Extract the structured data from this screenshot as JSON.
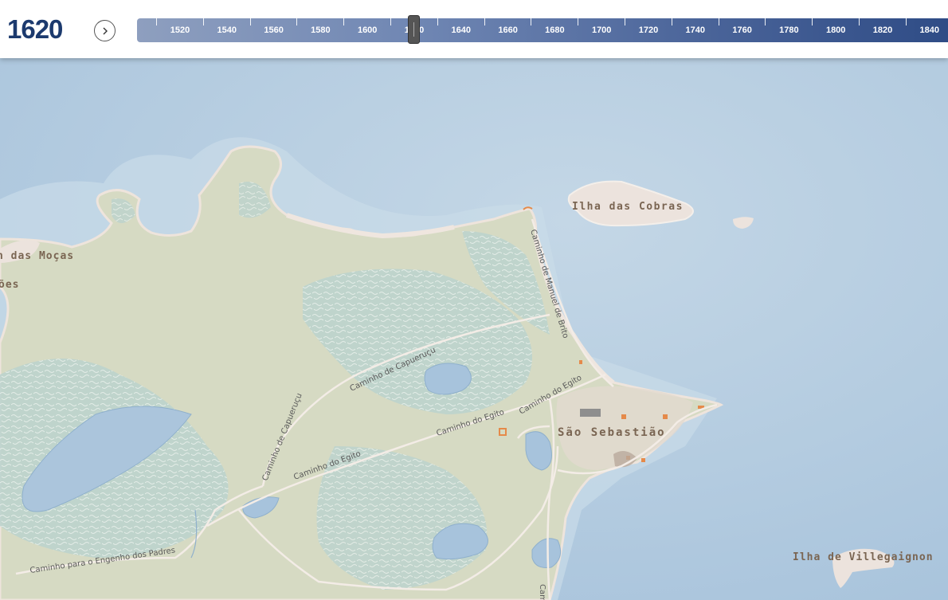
{
  "header": {
    "year": "1620",
    "next_label": "›"
  },
  "timeline": {
    "ticks": [
      "1520",
      "1540",
      "1560",
      "1580",
      "1600",
      "1620",
      "1640",
      "1660",
      "1680",
      "1700",
      "1720",
      "1740",
      "1760",
      "1780",
      "1800",
      "1820",
      "1840"
    ],
    "selected_year": 1620
  },
  "map": {
    "places": {
      "ilha_das_cobras": "Ilha das Cobras",
      "sao_sebastiao": "São Sebastião",
      "ilha_de_villegaignon": "Ilha de Villegaignon",
      "ilha_das_mocas": "n das Moças",
      "partial_oes": "ões"
    },
    "roads": {
      "manuel_de_brito": "Caminho de Manuel de Brito",
      "capuerucu_1": "Caminho de Capueruçu",
      "capuerucu_2": "Caminho de Capueruçu",
      "egito_1": "Caminho do Egito",
      "egito_2": "Caminho do Egito",
      "egito_3": "Caminho do Egito",
      "engenho": "Caminho para o Engenho dos Padres",
      "partial_cam": "Cam"
    },
    "colors": {
      "water": "#b9d1e2",
      "land": "#d9dcc6",
      "marsh": "#b9d3ce",
      "beach": "#eee4dc",
      "road": "#f3ece6",
      "building": "#e58a4a"
    }
  }
}
